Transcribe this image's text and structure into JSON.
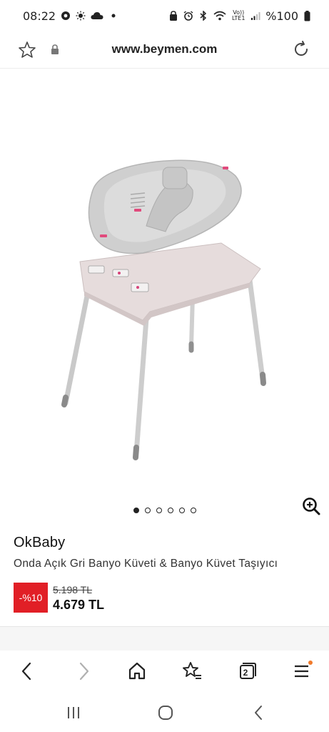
{
  "status_bar": {
    "time": "08:22",
    "battery": "%100",
    "network": "LTE1",
    "volte": "Vo))",
    "left_icons": [
      "chrome-icon",
      "brightness-icon",
      "cloud-icon",
      "dot-icon"
    ],
    "right_icons": [
      "bluetooth-icon",
      "alarm-icon",
      "wifi-icon",
      "signal-icon",
      "battery-icon"
    ]
  },
  "browser": {
    "url": "www.beymen.com"
  },
  "gallery": {
    "image_count": 6,
    "active_index": 0,
    "image_subject": "baby-bath-tub-with-stand"
  },
  "product": {
    "brand": "OkBaby",
    "name": "Onda Açık Gri Banyo Küveti & Banyo Küvet Taşıyıcı",
    "discount": "-%10",
    "old_price": "5.198 TL",
    "price": "4.679 TL"
  },
  "bottom_nav": {
    "tab_count": "2",
    "menu_notification": true
  },
  "colors": {
    "discount_bg": "#e11f26",
    "notification": "#f07a2b",
    "text": "#222222"
  }
}
